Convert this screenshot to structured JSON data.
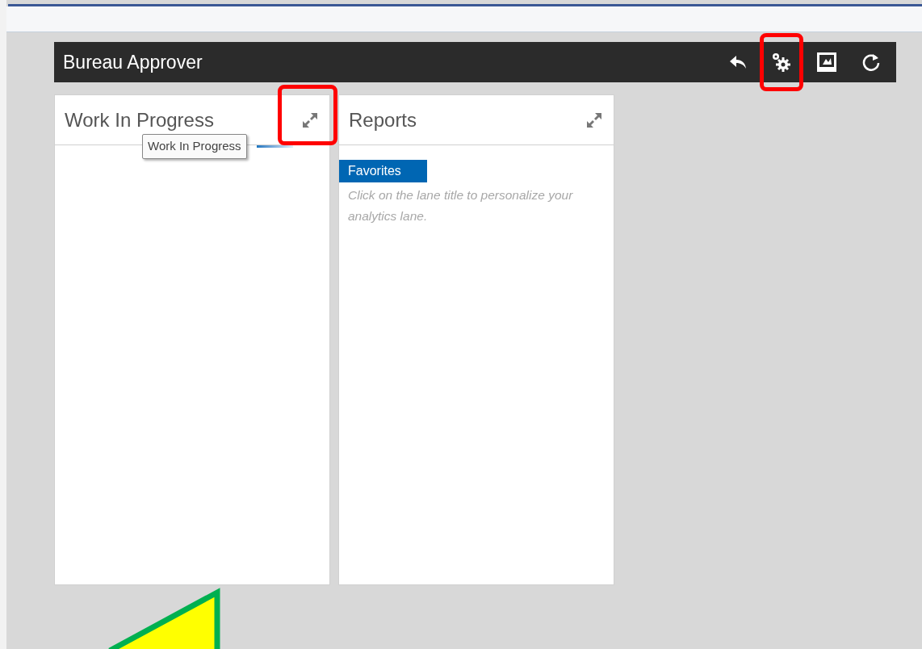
{
  "header": {
    "title": "Bureau Approver"
  },
  "lanes": [
    {
      "title": "Work In Progress",
      "tooltip": "Work In Progress"
    },
    {
      "title": "Reports",
      "tab": "Favorites",
      "hint": "Click on the lane title to personalize your analytics lane."
    }
  ]
}
